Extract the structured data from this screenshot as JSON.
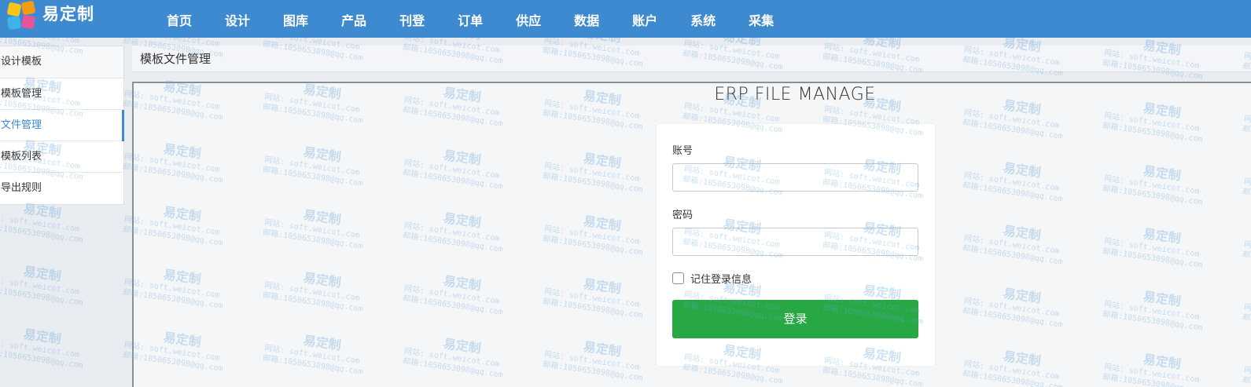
{
  "brand": {
    "name": "易定制"
  },
  "nav": [
    "首页",
    "设计",
    "图库",
    "产品",
    "刊登",
    "订单",
    "供应",
    "数据",
    "账户",
    "系统",
    "采集"
  ],
  "sidebar": {
    "title": "设计模板",
    "items": [
      {
        "label": "模板管理",
        "active": false
      },
      {
        "label": "文件管理",
        "active": true
      },
      {
        "label": "模板列表",
        "active": false
      },
      {
        "label": "导出规则",
        "active": false
      }
    ]
  },
  "main": {
    "title": "模板文件管理"
  },
  "login": {
    "heading": "ERP FILE MANAGE",
    "account_label": "账号",
    "account_value": "",
    "password_label": "密码",
    "password_value": "",
    "remember_label": "记住登录信息",
    "remember_checked": false,
    "submit_label": "登录"
  },
  "watermark": {
    "title": "易定制",
    "site": "网站: soft.weicot.com",
    "email": "邮箱:1050653098@qq.com"
  },
  "colors": {
    "topbar": "#3d8ad0",
    "accent": "#3d8ad0",
    "submit": "#28a745"
  }
}
